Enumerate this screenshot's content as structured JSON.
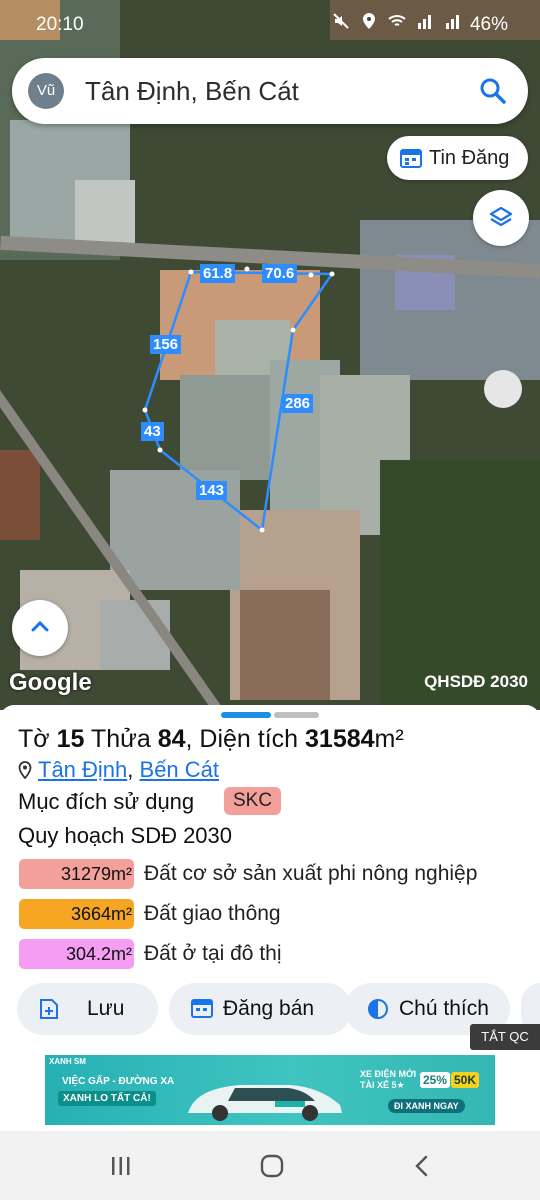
{
  "status_bar": {
    "time": "20:10",
    "battery": "46%"
  },
  "search": {
    "avatar": "Vũ",
    "query": "Tân Định, Bến Cát",
    "icon": "search-icon"
  },
  "map": {
    "tin_dang_label": "Tin Đăng",
    "edge_labels": [
      "61.8",
      "70.6",
      "156",
      "286",
      "43",
      "143"
    ],
    "google_label": "Google",
    "plan_label": "QHSDĐ 2030",
    "boundary_color": "#2f8cff"
  },
  "sheet": {
    "title_pre": "Tờ ",
    "sheet_no": "15",
    "title_mid": " Thửa ",
    "parcel_no": "84",
    "title_area_label": ", Diện tích ",
    "area": "31584",
    "area_unit": "m²",
    "ward": "Tân Định",
    "separator": ", ",
    "town": "Bến Cát",
    "purpose_label": "Mục đích sử dụng",
    "purpose_code": "SKC",
    "plan_title": "Quy hoạch SDĐ 2030",
    "plan_rows": [
      {
        "area": "31279m²",
        "desc": "Đất cơ sở sản xuất phi nông nghiệp",
        "color": "#f4a09a"
      },
      {
        "area": "3664m²",
        "desc": "Đất giao thông",
        "color": "#f6a623"
      },
      {
        "area": "304.2m²",
        "desc": "Đất ở tại đô thị",
        "color": "#f59cf3"
      }
    ],
    "actions": [
      {
        "label": "Lưu",
        "icon": "save-add-icon"
      },
      {
        "label": "Đăng bán",
        "icon": "calendar-icon"
      },
      {
        "label": "Chú thích",
        "icon": "legend-icon"
      }
    ]
  },
  "ad": {
    "close_label": "TẮT QC",
    "brand": "XANH SM",
    "headline": "VIỆC GẤP - ĐƯỜNG XA",
    "tagline": "XANH LO TẤT CẢ!",
    "promo_title": "XE ĐIỆN MỚI\nTÀI XẾ 5★",
    "discount_pct": "25%",
    "discount_amount": "50K",
    "cta": "ĐI XANH NGAY"
  }
}
